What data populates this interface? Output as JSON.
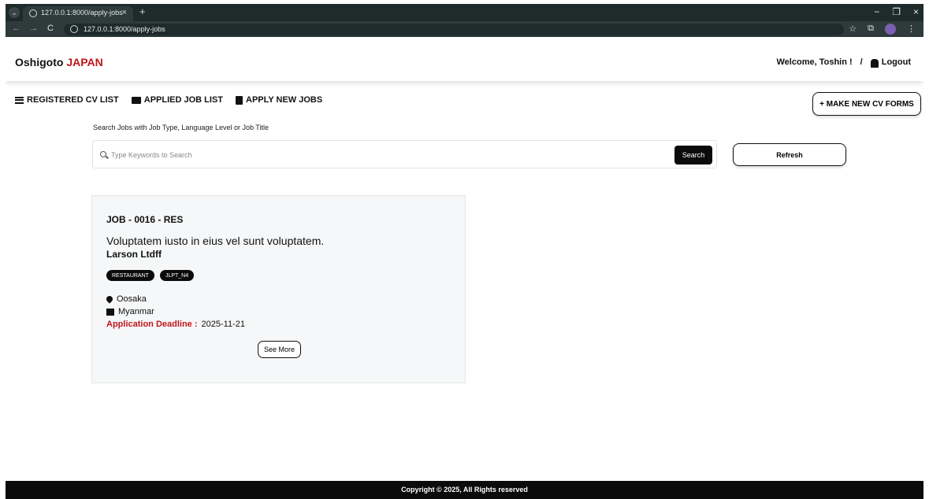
{
  "browser": {
    "tab_title": "127.0.0.1:8000/apply-jobs",
    "tab_close": "×",
    "new_tab": "+",
    "url": "127.0.0.1:8000/apply-jobs",
    "back": "←",
    "forward": "→",
    "reload": "C",
    "win_min": "−",
    "win_restore": "❐",
    "win_close": "×",
    "bookmark": "☆",
    "extensions": "⧉"
  },
  "header": {
    "brand_main": "Oshigoto",
    "brand_accent": "JAPAN",
    "welcome": "Welcome, Toshin !",
    "separator": "/",
    "logout": "Logout"
  },
  "nav": {
    "items": [
      {
        "label": "REGISTERED CV LIST",
        "icon": "list-icon"
      },
      {
        "label": "APPLIED JOB LIST",
        "icon": "laptop-icon"
      },
      {
        "label": "APPLY NEW JOBS",
        "icon": "building-icon"
      }
    ],
    "new_cv_button": "+ MAKE NEW CV FORMS"
  },
  "search": {
    "hint": "Search Jobs with Job Type, Language Level or Job Title",
    "placeholder": "Type Keywords to Search",
    "button": "Search",
    "refresh": "Refresh"
  },
  "jobs": [
    {
      "code": "JOB - 0016 - RES",
      "title": "Voluptatem iusto in eius vel sunt voluptatem.",
      "company": "Larson Ltdff",
      "tags": [
        "RESTAURANT",
        "JLPT_N4"
      ],
      "location": "Oosaka",
      "country": "Myanmar",
      "deadline_label": "Application Deadline :",
      "deadline": "2025-11-21",
      "see_more": "See More"
    }
  ],
  "footer": {
    "copyright": "Copyright © 2025, All Rights reserved"
  },
  "colors": {
    "accent": "#c0161b",
    "dark": "#0b0b0b",
    "chrome": "#1f2a2a"
  }
}
